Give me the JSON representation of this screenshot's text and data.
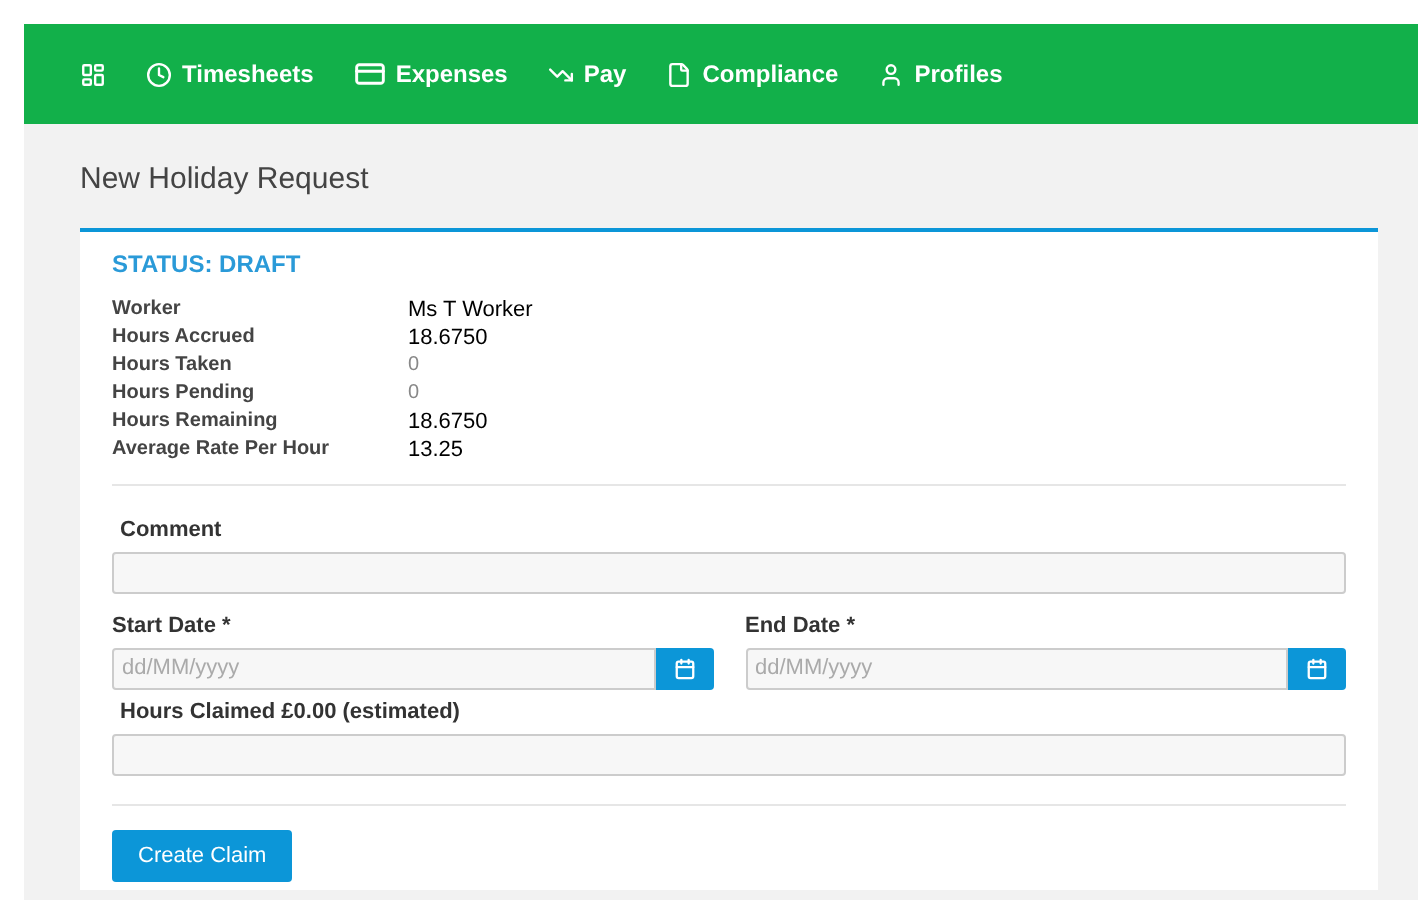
{
  "nav": [
    {
      "kind": "dashboard"
    },
    {
      "kind": "clock",
      "label": "Timesheets"
    },
    {
      "kind": "card",
      "label": "Expenses"
    },
    {
      "kind": "trend",
      "label": "Pay"
    },
    {
      "kind": "file",
      "label": "Compliance"
    },
    {
      "kind": "user",
      "label": "Profiles"
    }
  ],
  "page_title": "New Holiday Request",
  "status": "STATUS: DRAFT",
  "details": [
    {
      "label": "Worker",
      "value": "Ms T Worker",
      "muted": false
    },
    {
      "label": "Hours Accrued",
      "value": "18.6750",
      "muted": false
    },
    {
      "label": "Hours Taken",
      "value": "0",
      "muted": true
    },
    {
      "label": "Hours Pending",
      "value": "0",
      "muted": true
    },
    {
      "label": "Hours Remaining",
      "value": "18.6750",
      "muted": false
    },
    {
      "label": "Average Rate Per Hour",
      "value": "13.25",
      "muted": false
    }
  ],
  "comment": {
    "label": "Comment"
  },
  "start_date": {
    "label": "Start Date *",
    "placeholder": "dd/MM/yyyy"
  },
  "end_date": {
    "label": "End Date *",
    "placeholder": "dd/MM/yyyy"
  },
  "hours_claimed": {
    "label": "Hours Claimed £0.00 (estimated)"
  },
  "submit": "Create Claim"
}
